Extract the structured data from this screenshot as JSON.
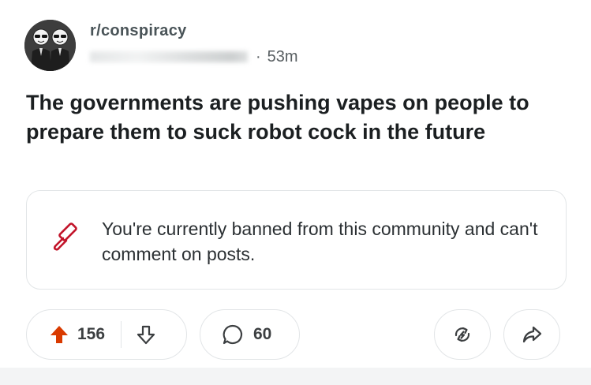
{
  "post": {
    "community": "r/conspiracy",
    "separator": "·",
    "age": "53m",
    "title": "The governments are pushing vapes on people to prepare them to suck robot cock in the future"
  },
  "ban_notice": {
    "text": "You're currently banned from this community and can't comment on posts.",
    "icon": "gavel-icon",
    "icon_color": "#c2142a"
  },
  "actions": {
    "vote_count": "156",
    "upvote_color": "#d93a00",
    "comment_count": "60",
    "crosspost_icon": "crosspost-icon",
    "share_icon": "share-icon"
  }
}
